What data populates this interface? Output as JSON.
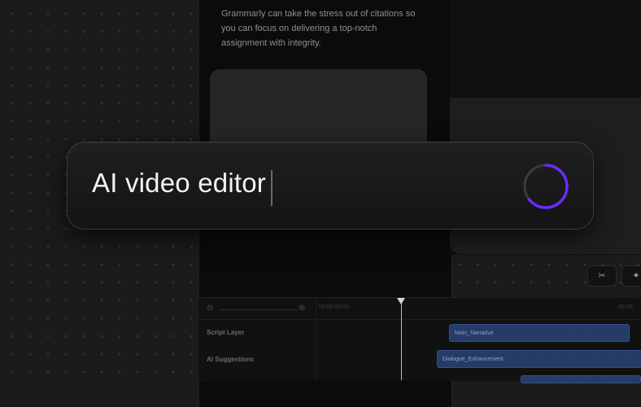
{
  "background": {
    "color": "#1b1b1b",
    "dot_color": "#343434"
  },
  "phone": {
    "body_text": "Grammarly can take the stress out of citations so you can focus on delivering a top-notch assignment with integrity."
  },
  "toolbar": {
    "buttons": [
      {
        "icon": "scissors-icon",
        "glyph": "✂"
      },
      {
        "icon": "sparkle-icon",
        "glyph": "✦"
      }
    ]
  },
  "timeline": {
    "zoom_out_glyph": "⊖",
    "zoom_in_glyph": "⊕",
    "ticks": [
      "00:00:00:00",
      "00:00:"
    ],
    "tracks": [
      {
        "label": "Script Layer",
        "clip": "Main_Narrative"
      },
      {
        "label": "AI Suggestions",
        "clip": "Dialogue_Enhancement"
      }
    ]
  },
  "search": {
    "value": "AI video editor",
    "status": "loading",
    "accent_color": "#6a2cff"
  }
}
